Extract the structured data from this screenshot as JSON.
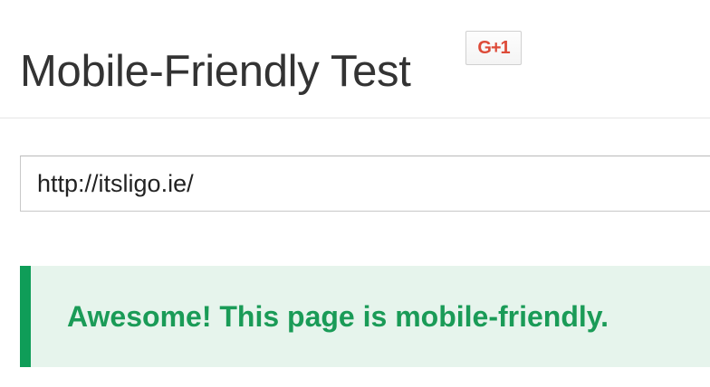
{
  "header": {
    "title": "Mobile-Friendly Test",
    "gplus_label": "G+1"
  },
  "form": {
    "url_value": "http://itsligo.ie/"
  },
  "result": {
    "message": "Awesome! This page is mobile-friendly."
  },
  "colors": {
    "accent_green": "#0f9d58",
    "banner_background": "#e6f4ec",
    "gplus_red": "#dd4b39"
  },
  "icons": {
    "gplus": "google-plus-one-icon"
  }
}
